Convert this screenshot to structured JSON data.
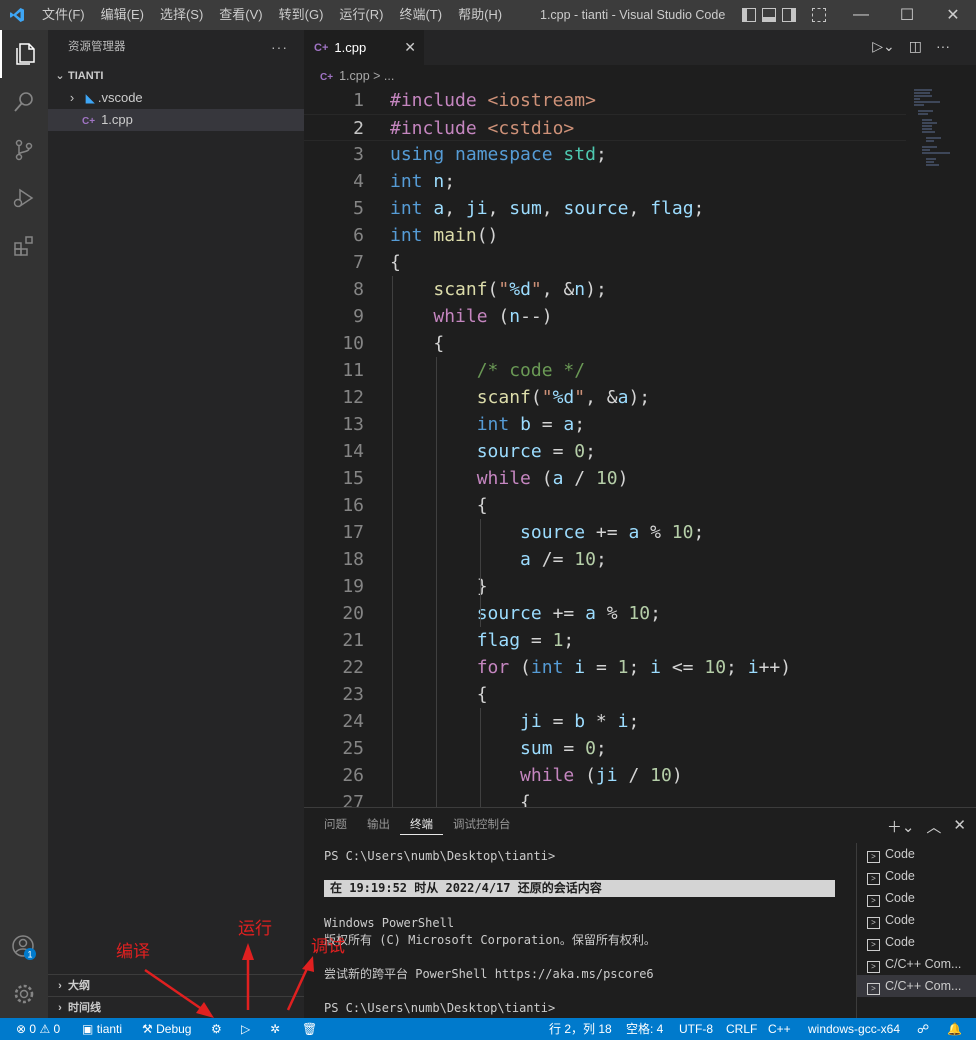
{
  "titlebar": {
    "menu": [
      "文件(F)",
      "编辑(E)",
      "选择(S)",
      "查看(V)",
      "转到(G)",
      "运行(R)",
      "终端(T)",
      "帮助(H)"
    ],
    "title": "1.cpp - tianti - Visual Studio Code",
    "minimize": "—",
    "maximize": "☐",
    "close": "✕"
  },
  "sidebar": {
    "header": "资源管理器",
    "more": "···",
    "root": "TIANTI",
    "items": [
      {
        "label": ".vscode",
        "icon": "vscode-folder-icon"
      },
      {
        "label": "1.cpp",
        "icon": "cpp-file-icon"
      }
    ],
    "outline": "大纲",
    "timeline": "时间线"
  },
  "editor": {
    "tab_lang": "C+",
    "tab_name": "1.cpp",
    "tab_close": "✕",
    "breadcrumb_file": "1.cpp",
    "breadcrumb_rest": " > ...",
    "current_line": 2,
    "lines": [
      "#include <iostream>",
      "#include <cstdio>",
      "using namespace std;",
      "int n;",
      "int a, ji, sum, source, flag;",
      "int main()",
      "{",
      "    scanf(\"%d\", &n);",
      "    while (n--)",
      "    {",
      "        /* code */",
      "        scanf(\"%d\", &a);",
      "        int b = a;",
      "        source = 0;",
      "        while (a / 10)",
      "        {",
      "            source += a % 10;",
      "            a /= 10;",
      "        }",
      "        source += a % 10;",
      "        flag = 1;",
      "        for (int i = 1; i <= 10; i++)",
      "        {",
      "            ji = b * i;",
      "            sum = 0;",
      "            while (ji / 10)",
      "            {"
    ]
  },
  "panel": {
    "tabs": [
      "问题",
      "输出",
      "终端",
      "调试控制台"
    ],
    "active_tab": "终端",
    "terminal_lines": {
      "prompt1": "PS C:\\Users\\numb\\Desktop\\tianti>",
      "banner": "在 19:19:52 时从 2022/4/17 还原的会话内容",
      "ps_title": "Windows PowerShell",
      "copyright": "版权所有 (C) Microsoft Corporation。保留所有权利。",
      "try_new": "尝试新的跨平台 PowerShell https://aka.ms/pscore6",
      "prompt2": "PS C:\\Users\\numb\\Desktop\\tianti>"
    },
    "terminals": [
      "Code",
      "Code",
      "Code",
      "Code",
      "Code",
      "C/C++ Com...",
      "C/C++ Com..."
    ]
  },
  "statusbar": {
    "errors": "0",
    "warnings": "0",
    "folder": "tianti",
    "debug": "Debug",
    "position": "行 2，列 18",
    "spaces": "空格: 4",
    "encoding": "UTF-8",
    "eol": "CRLF",
    "language": "C++",
    "compiler": "windows-gcc-x64",
    "badge": "1"
  },
  "annotations": {
    "compile": "编译",
    "run": "运行",
    "debug": "调试"
  },
  "colors": {
    "accent": "#007acc",
    "annotation": "#e02020"
  }
}
